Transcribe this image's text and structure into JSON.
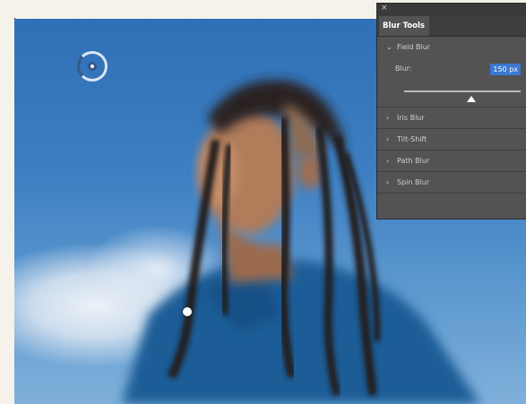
{
  "panel": {
    "close_glyph": "×",
    "tab_label": "Blur Tools",
    "sections": [
      {
        "label": "Field Blur",
        "expanded": true,
        "chevron": "⌄"
      },
      {
        "label": "Iris Blur",
        "expanded": false,
        "chevron": "›"
      },
      {
        "label": "Tilt-Shift",
        "expanded": false,
        "chevron": "›"
      },
      {
        "label": "Path Blur",
        "expanded": false,
        "chevron": "›"
      },
      {
        "label": "Spin Blur",
        "expanded": false,
        "chevron": "›"
      }
    ],
    "blur": {
      "label": "Blur:",
      "value": "150 px",
      "slider_fraction": 0.58
    }
  },
  "colors": {
    "panel_bg": "#535353",
    "accent": "#3b78d1",
    "sky": "#3d7fc2",
    "jacket": "#1f5d97"
  },
  "icons": {
    "blur_pin": "field-blur-pin-icon",
    "close": "close-icon"
  }
}
